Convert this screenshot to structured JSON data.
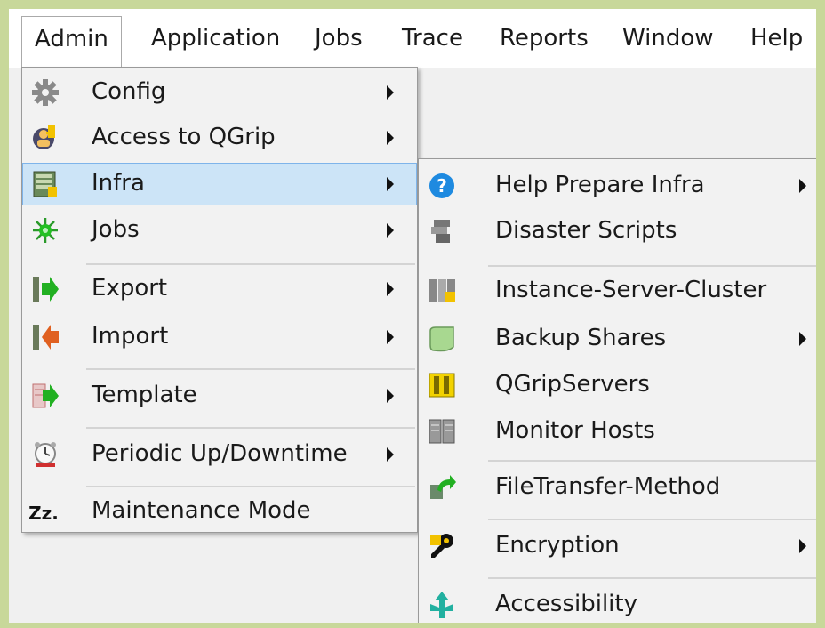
{
  "menubar": {
    "items": [
      "Admin",
      "Application",
      "Jobs",
      "Trace",
      "Reports",
      "Window",
      "Help"
    ]
  },
  "admin_menu": {
    "items": [
      {
        "label": "Config",
        "icon": "gear-icon",
        "submenu": true
      },
      {
        "label": "Access to QGrip",
        "icon": "key-user-icon",
        "submenu": true
      },
      {
        "label": "Infra",
        "icon": "server-icon",
        "submenu": true
      },
      {
        "label": "Jobs",
        "icon": "sun-icon",
        "submenu": true
      },
      {
        "label": "Export",
        "icon": "export-icon",
        "submenu": true
      },
      {
        "label": "Import",
        "icon": "import-icon",
        "submenu": true
      },
      {
        "label": "Template",
        "icon": "template-icon",
        "submenu": true
      },
      {
        "label": "Periodic Up/Downtime",
        "icon": "alarm-clock-icon",
        "submenu": true
      },
      {
        "label": "Maintenance Mode",
        "icon": "sleep-icon",
        "icon_text": "Zz.",
        "submenu": false
      }
    ]
  },
  "infra_menu": {
    "items": [
      {
        "label": "Help Prepare Infra",
        "icon": "help-icon",
        "submenu": true
      },
      {
        "label": "Disaster Scripts",
        "icon": "scripts-icon",
        "submenu": false
      },
      {
        "label": "Instance-Server-Cluster",
        "icon": "cluster-icon",
        "submenu": false
      },
      {
        "label": "Backup Shares",
        "icon": "share-icon",
        "submenu": true
      },
      {
        "label": "QGripServers",
        "icon": "qgrip-servers-icon",
        "submenu": false
      },
      {
        "label": "Monitor Hosts",
        "icon": "monitor-hosts-icon",
        "submenu": false
      },
      {
        "label": "FileTransfer-Method",
        "icon": "file-transfer-icon",
        "submenu": false
      },
      {
        "label": "Encryption",
        "icon": "key-icon",
        "submenu": true
      },
      {
        "label": "Accessibility",
        "icon": "accessibility-icon",
        "submenu": false
      }
    ]
  },
  "colors": {
    "highlight": "#cce4f7",
    "highlight_border": "#7eb4ea",
    "outer_frame": "#c8d89a"
  }
}
